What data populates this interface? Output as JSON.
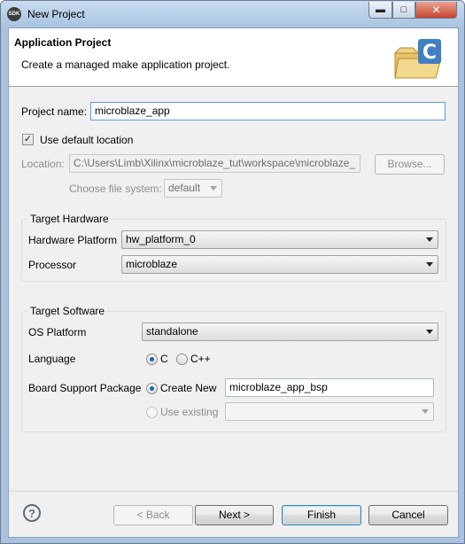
{
  "window": {
    "title": "New Project",
    "app_icon_text": "SDK"
  },
  "header": {
    "title": "Application Project",
    "description": "Create a managed make application project.",
    "graphic_letter": "C"
  },
  "project": {
    "name_label": "Project name:",
    "name_value": "microblaze_app",
    "use_default_label": "Use default location",
    "use_default_checked": true,
    "location_label": "Location:",
    "location_value": "C:\\Users\\Limb\\Xilinx\\microblaze_tut\\workspace\\microblaze_",
    "browse_label": "Browse...",
    "filesystem_label": "Choose file system:",
    "filesystem_value": "default"
  },
  "target_hardware": {
    "title": "Target Hardware",
    "platform_label": "Hardware Platform",
    "platform_value": "hw_platform_0",
    "processor_label": "Processor",
    "processor_value": "microblaze"
  },
  "target_software": {
    "title": "Target Software",
    "os_label": "OS Platform",
    "os_value": "standalone",
    "language_label": "Language",
    "language_c": "C",
    "language_cpp": "C++",
    "bsp_label": "Board Support Package",
    "create_new_label": "Create New",
    "bsp_name_value": "microblaze_app_bsp",
    "use_existing_label": "Use existing"
  },
  "buttons": {
    "back": "< Back",
    "next": "Next >",
    "finish": "Finish",
    "cancel": "Cancel",
    "help": "?"
  }
}
